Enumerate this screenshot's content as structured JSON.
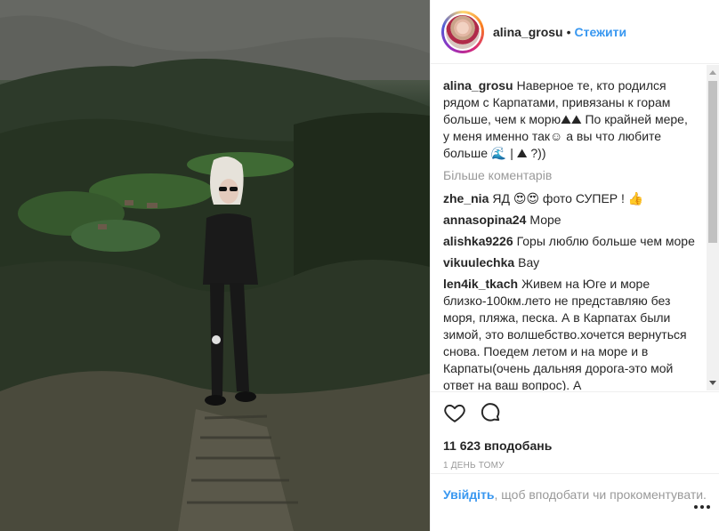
{
  "post": {
    "photo_description_icon": "landscape-photo",
    "header": {
      "username": "alina_grosu",
      "separator": "•",
      "follow_label": "Стежити"
    },
    "caption": {
      "author": "alina_grosu",
      "text": "Наверное те, кто родился рядом с Карпатами, привязаны к горам больше, чем к морю⛰⛰ По крайней мере, у меня именно так☺ а вы что любите больше 🌊 | ⛰ ?))"
    },
    "more_comments_label": "Більше коментарів",
    "comments": [
      {
        "author": "zhe_nia",
        "text": "ЯД 😍😍 фото СУПЕР ! 👍"
      },
      {
        "author": "annasopina24",
        "text": "Море"
      },
      {
        "author": "alishka9226",
        "text": "Горы люблю больше чем море"
      },
      {
        "author": "vikuulechka",
        "text": "Вау"
      },
      {
        "author": "len4ik_tkach",
        "text": "Живем на Юге и море близко-100км.лето не представляю без моря, пляжа, песка. А в Карпатах были зимой, это волшебство.хочется вернуться снова. Поедем летом и на море и в Карпаты(очень дальняя дорога-это мой ответ на ваш вопрос). А"
      }
    ],
    "likes_text": "11 623 вподобань",
    "time_text": "1 день тому",
    "login_prompt": {
      "link": "Увійдіть",
      "text": ", щоб вподобати чи прокоментувати."
    }
  },
  "icons": {
    "like": "heart-outline-icon",
    "comment": "speech-bubble-icon",
    "more": "more-options-icon"
  },
  "colors": {
    "link": "#3897f0",
    "text": "#262626",
    "muted": "#999999",
    "border": "#efefef"
  }
}
